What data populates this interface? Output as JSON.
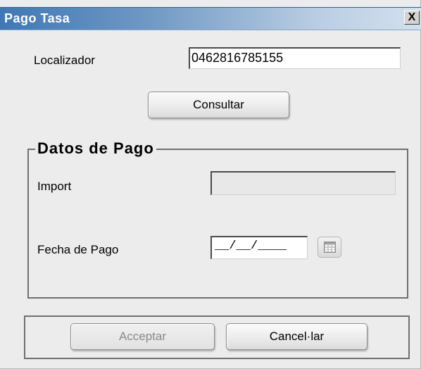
{
  "window": {
    "title": "Pago Tasa",
    "close_glyph": "X"
  },
  "search": {
    "localizador_label": "Localizador",
    "localizador_value": "0462816785155",
    "consultar_label": "Consultar"
  },
  "datos_pago": {
    "legend": "Datos de Pago",
    "import_label": "Import",
    "import_value": "",
    "fecha_label": "Fecha de Pago",
    "fecha_value": "__/__/____",
    "calendar_icon": "calendar-icon"
  },
  "actions": {
    "acceptar_label": "Acceptar",
    "cancelar_label": "Cancel·lar"
  },
  "colors": {
    "titlebar_start": "#3f78b5",
    "titlebar_end": "#d3e0ee",
    "window_bg": "#ececec"
  }
}
